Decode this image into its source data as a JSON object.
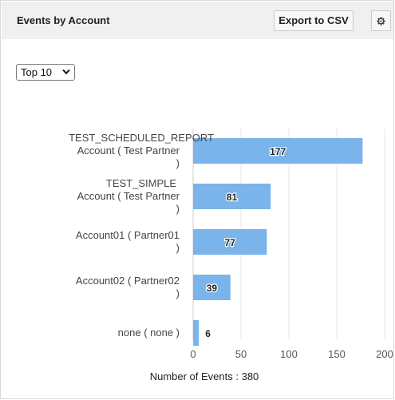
{
  "widget": {
    "title": "Events by Account",
    "export_label": "Export to CSV",
    "settings_icon": "gear-icon",
    "top_select": {
      "selected": "Top 10"
    }
  },
  "chart_data": {
    "type": "bar",
    "orientation": "horizontal",
    "categories": [
      [
        "TEST_SCHEDULED_REPORT",
        "Account ( Test Partner",
        ")"
      ],
      [
        "TEST_SIMPLE",
        "Account ( Test Partner",
        ")"
      ],
      [
        "Account01 ( Partner01",
        ")"
      ],
      [
        "Account02 ( Partner02",
        ")"
      ],
      [
        "none ( none )"
      ]
    ],
    "values": [
      177,
      81,
      77,
      39,
      6
    ],
    "xlim": [
      0,
      200
    ],
    "xticks": [
      0,
      50,
      100,
      150,
      200
    ],
    "xlabel": "Number of Events : 380",
    "grid": "vertical",
    "bar_color": "#7ab4ea"
  }
}
